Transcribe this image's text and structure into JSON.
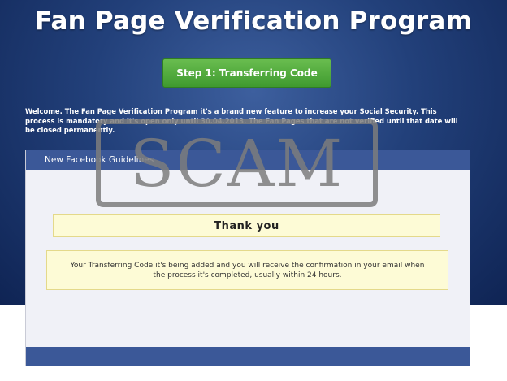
{
  "header": {
    "title": "Fan Page Verification Program"
  },
  "step_button": {
    "label": "Step 1: Transferring Code"
  },
  "intro": {
    "text": "Welcome. The Fan Page Verification Program it's a brand new feature to increase your Social Security. This process is mandatory and it's open only until 30.04.2013. The Fan Pages that are not verified until that date will be closed permanently."
  },
  "panel": {
    "header_label": "New Facebook Guidelines",
    "thank_you": "Thank you",
    "message": "Your Transferring Code it's being added and you will receive the confirmation in your email when the process it's completed, usually within 24 hours."
  },
  "watermark": {
    "text": "SCAM"
  },
  "colors": {
    "facebook_blue": "#3b5898",
    "button_green": "#4ea83b",
    "note_yellow": "#fdfbd6",
    "stamp_gray": "#7d7d7d"
  }
}
